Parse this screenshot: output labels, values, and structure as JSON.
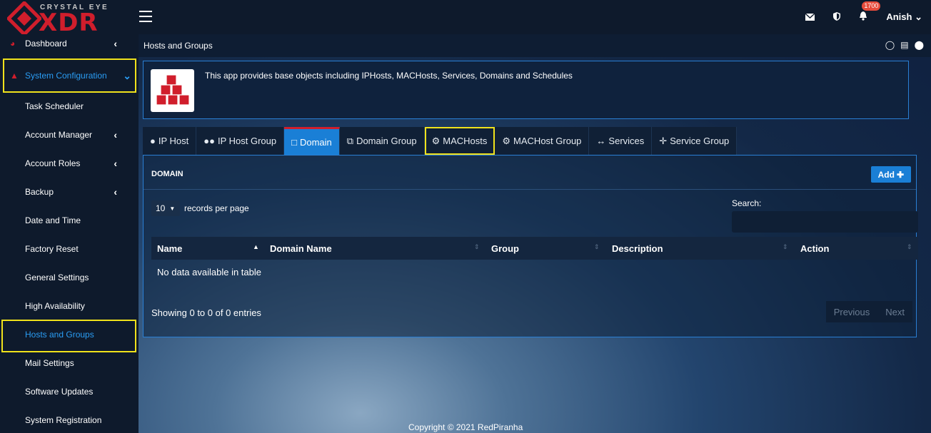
{
  "brand": {
    "tagline": "CRYSTAL EYE",
    "name": "XDR"
  },
  "topbar": {
    "notification_count": "1700",
    "user": "Anish"
  },
  "sidebar": {
    "items": [
      {
        "label": "Dashboard"
      },
      {
        "label": "System Configuration"
      },
      {
        "label": "Task Scheduler"
      },
      {
        "label": "Account Manager"
      },
      {
        "label": "Account Roles"
      },
      {
        "label": "Backup"
      },
      {
        "label": "Date and Time"
      },
      {
        "label": "Factory Reset"
      },
      {
        "label": "General Settings"
      },
      {
        "label": "High Availability"
      },
      {
        "label": "Hosts and Groups"
      },
      {
        "label": "Mail Settings"
      },
      {
        "label": "Software Updates"
      },
      {
        "label": "System Registration"
      }
    ]
  },
  "breadcrumb": "Hosts and Groups",
  "app": {
    "description": "This app provides base objects including IPHosts, MACHosts, Services, Domains and Schedules"
  },
  "tabs": [
    {
      "label": "IP Host",
      "icon": "user-icon"
    },
    {
      "label": "IP Host Group",
      "icon": "users-icon"
    },
    {
      "label": "Domain",
      "icon": "file-icon"
    },
    {
      "label": "Domain Group",
      "icon": "clone-icon"
    },
    {
      "label": "MACHosts",
      "icon": "gear-icon"
    },
    {
      "label": "MACHost Group",
      "icon": "gears-icon"
    },
    {
      "label": "Services",
      "icon": "arrows-h-icon"
    },
    {
      "label": "Service Group",
      "icon": "arrows-icon"
    }
  ],
  "panel": {
    "title": "DOMAIN",
    "add_label": "Add",
    "length_value": "10",
    "length_label": "records per page",
    "search_label": "Search:",
    "columns": [
      "Name",
      "Domain Name",
      "Group",
      "Description",
      "Action"
    ],
    "empty_text": "No data available in table",
    "info": "Showing 0 to 0 of 0 entries",
    "prev_label": "Previous",
    "next_label": "Next"
  },
  "footer": {
    "copyright": "Copyright © 2021 RedPiranha"
  },
  "colors": {
    "accent": "#1a7fd6",
    "brand_red": "#d01e2c",
    "highlight": "#f0e21b"
  }
}
